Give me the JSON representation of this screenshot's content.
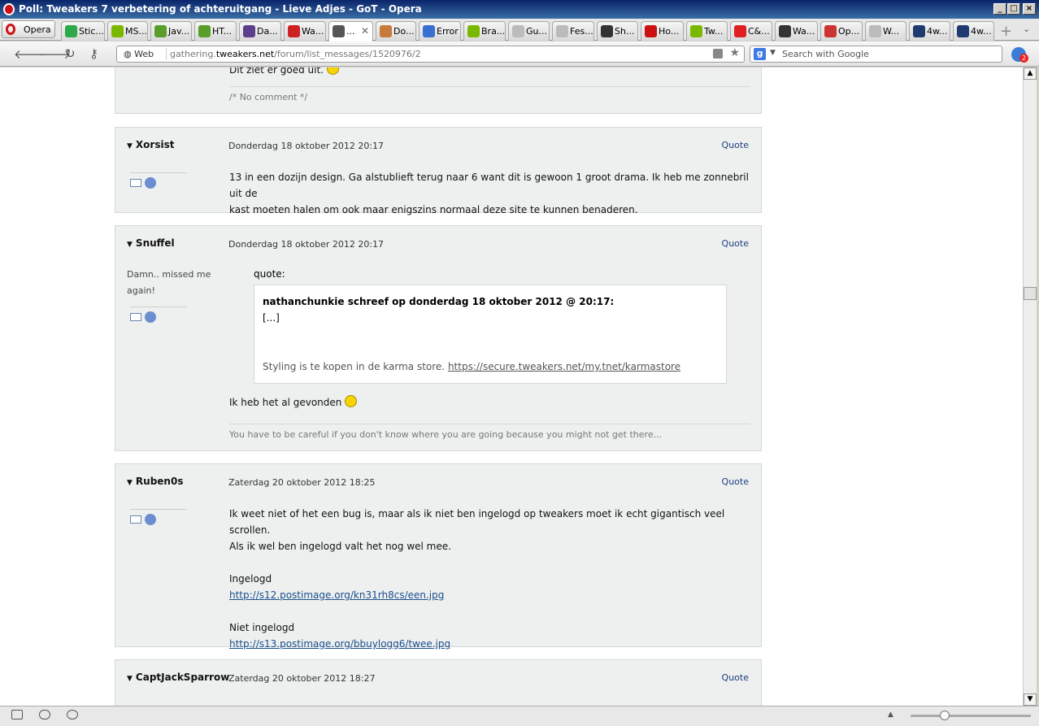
{
  "window": {
    "title": "Poll: Tweakers 7 verbetering of achteruitgang - Lieve Adjes - GoT - Opera"
  },
  "opera_button": "Opera",
  "tabs": [
    {
      "label": "Stic...",
      "color": "#2ca94a"
    },
    {
      "label": "MS...",
      "color": "#7ab800"
    },
    {
      "label": "Jav...",
      "color": "#5a9e2a"
    },
    {
      "label": "HT...",
      "color": "#5a9e2a"
    },
    {
      "label": "Da...",
      "color": "#5b3f8c"
    },
    {
      "label": "Wa...",
      "color": "#cc2222"
    },
    {
      "label": "...",
      "color": "#555555"
    },
    {
      "label": "Do...",
      "color": "#c87a3a"
    },
    {
      "label": "Error",
      "color": "#3a6ed0"
    },
    {
      "label": "Bra...",
      "color": "#7ab800"
    },
    {
      "label": "Gu...",
      "color": "#bbbbbb"
    },
    {
      "label": "Fes...",
      "color": "#bbbbbb"
    },
    {
      "label": "Sh...",
      "color": "#333333"
    },
    {
      "label": "Ho...",
      "color": "#cc1111"
    },
    {
      "label": "Tw...",
      "color": "#7ab800"
    },
    {
      "label": "C&...",
      "color": "#e02020"
    },
    {
      "label": "Wa...",
      "color": "#333333"
    },
    {
      "label": "Op...",
      "color": "#cc3333"
    },
    {
      "label": "W...",
      "color": "#bbbbbb"
    },
    {
      "label": "4w...",
      "color": "#1e3a6e"
    },
    {
      "label": "4w...",
      "color": "#1e3a6e"
    }
  ],
  "address": {
    "web_label": "Web",
    "url_prefix": "gathering.",
    "url_domain": "tweakers.net",
    "url_path": "/forum/list_messages/1520976/2"
  },
  "search": {
    "placeholder": "Search with Google",
    "badge": "2"
  },
  "partial_post": {
    "text": "Dit ziet er goed uit.",
    "signature": "/* No comment */"
  },
  "posts": [
    {
      "author": "Xorsist",
      "date": "Donderdag 18 oktober 2012 20:17",
      "quote_label": "Quote",
      "lines": [
        "13 in een dozijn design. Ga alstublieft terug naar 6 want dit is gewoon 1 groot drama. Ik heb me zonnebril uit de",
        "kast moeten halen om ook maar enigszins normaal deze site te kunnen benaderen."
      ]
    },
    {
      "author": "Snuffel",
      "date": "Donderdag 18 oktober 2012 20:17",
      "quote_label": "Quote",
      "user_title": "Damn.. missed me again!",
      "quote_intro": "quote:",
      "quote_header": "nathanchunkie schreef op donderdag 18 oktober 2012 @ 20:17:",
      "quote_body": "[...]",
      "quote_sig_text": "Styling is te kopen in de karma store. ",
      "quote_sig_link": "https://secure.tweakers.net/my.tnet/karmastore",
      "text": "Ik heb het al gevonden",
      "signature": "You have to be careful if you don't know where you are going because you might not get there..."
    },
    {
      "author": "Ruben0s",
      "date": "Zaterdag 20 oktober 2012 18:25",
      "quote_label": "Quote",
      "lines": [
        "Ik weet niet of het een bug is, maar als ik niet ben ingelogd op tweakers moet ik echt gigantisch veel scrollen.",
        "Als ik wel ben ingelogd valt het nog wel mee."
      ],
      "label1": "Ingelogd",
      "link1": "http://s12.postimage.org/kn31rh8cs/een.jpg",
      "label2": "Niet ingelogd",
      "link2": "http://s13.postimage.org/bbuylogg6/twee.jpg"
    },
    {
      "author": "CaptJackSparrow",
      "date": "Zaterdag 20 oktober 2012 18:27",
      "quote_label": "Quote"
    }
  ]
}
